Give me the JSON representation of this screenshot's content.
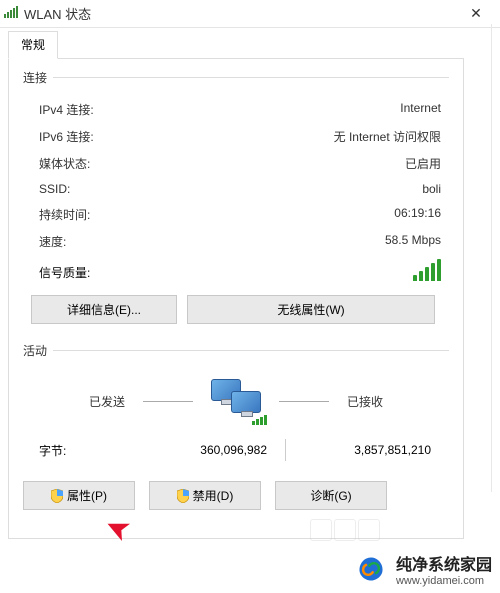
{
  "window": {
    "title": "WLAN 状态",
    "close_glyph": "✕"
  },
  "tabs": [
    {
      "label": "常规"
    }
  ],
  "connection": {
    "legend": "连接",
    "rows": {
      "ipv4": {
        "label": "IPv4 连接:",
        "value": "Internet"
      },
      "ipv6": {
        "label": "IPv6 连接:",
        "value": "无 Internet 访问权限"
      },
      "media": {
        "label": "媒体状态:",
        "value": "已启用"
      },
      "ssid": {
        "label": "SSID:",
        "value": "boli"
      },
      "duration": {
        "label": "持续时间:",
        "value": "06:19:16"
      },
      "speed": {
        "label": "速度:",
        "value": "58.5 Mbps"
      },
      "signal_quality": {
        "label": "信号质量:"
      }
    },
    "buttons": {
      "details": "详细信息(E)...",
      "wireless": "无线属性(W)"
    }
  },
  "activity": {
    "legend": "活动",
    "sent_label": "已发送",
    "received_label": "已接收",
    "bytes_label": "字节:",
    "sent_bytes": "360,096,982",
    "received_bytes": "3,857,851,210",
    "buttons": {
      "properties": "属性(P)",
      "disable": "禁用(D)",
      "diagnose": "诊断(G)"
    }
  },
  "watermark": {
    "cn": "纯净系统家园",
    "url": "www.yidamei.com"
  }
}
